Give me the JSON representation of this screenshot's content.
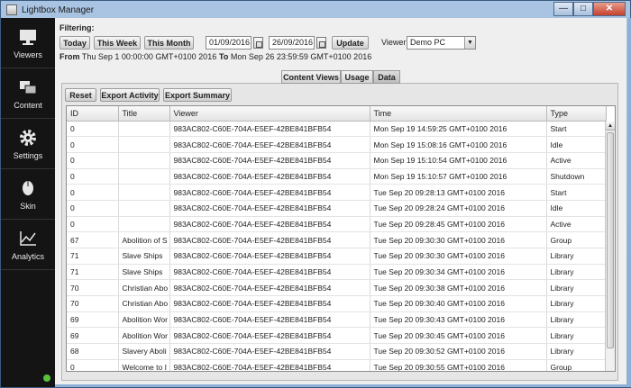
{
  "window": {
    "title": "Lightbox Manager",
    "min": "—",
    "max": "□",
    "close": "✕"
  },
  "sidebar": {
    "items": [
      {
        "label": "Viewers",
        "icon": "monitor-icon"
      },
      {
        "label": "Content",
        "icon": "content-icon"
      },
      {
        "label": "Settings",
        "icon": "gear-icon"
      },
      {
        "label": "Skin",
        "icon": "mouse-icon"
      },
      {
        "label": "Analytics",
        "icon": "chart-icon"
      }
    ]
  },
  "filter": {
    "title": "Filtering:",
    "today": "Today",
    "this_week": "This Week",
    "this_month": "This Month",
    "date_from": "01/09/2016",
    "date_to": "26/09/2016",
    "update": "Update",
    "viewer_label": "Viewer",
    "viewer_value": "Demo PC",
    "from_label": "From",
    "from_value": "Thu Sep 1 00:00:00 GMT+0100 2016",
    "to_label": "To",
    "to_value": "Mon Sep 26 23:59:59 GMT+0100 2016"
  },
  "tabs": [
    "Content Views",
    "Usage",
    "Data"
  ],
  "actions": {
    "reset": "Reset",
    "export_activity": "Export Activity",
    "export_summary": "Export Summary"
  },
  "table": {
    "columns": [
      "ID",
      "Title",
      "Viewer",
      "Time",
      "Type"
    ],
    "rows": [
      [
        "0",
        "",
        "983AC802-C60E-704A-E5EF-42BE841BFB54",
        "Mon Sep 19 14:59:25 GMT+0100 2016",
        "Start"
      ],
      [
        "0",
        "",
        "983AC802-C60E-704A-E5EF-42BE841BFB54",
        "Mon Sep 19 15:08:16 GMT+0100 2016",
        "Idle"
      ],
      [
        "0",
        "",
        "983AC802-C60E-704A-E5EF-42BE841BFB54",
        "Mon Sep 19 15:10:54 GMT+0100 2016",
        "Active"
      ],
      [
        "0",
        "",
        "983AC802-C60E-704A-E5EF-42BE841BFB54",
        "Mon Sep 19 15:10:57 GMT+0100 2016",
        "Shutdown"
      ],
      [
        "0",
        "",
        "983AC802-C60E-704A-E5EF-42BE841BFB54",
        "Tue Sep 20 09:28:13 GMT+0100 2016",
        "Start"
      ],
      [
        "0",
        "",
        "983AC802-C60E-704A-E5EF-42BE841BFB54",
        "Tue Sep 20 09:28:24 GMT+0100 2016",
        "Idle"
      ],
      [
        "0",
        "",
        "983AC802-C60E-704A-E5EF-42BE841BFB54",
        "Tue Sep 20 09:28:45 GMT+0100 2016",
        "Active"
      ],
      [
        "67",
        "Abolition of S",
        "983AC802-C60E-704A-E5EF-42BE841BFB54",
        "Tue Sep 20 09:30:30 GMT+0100 2016",
        "Group"
      ],
      [
        "71",
        "Slave Ships",
        "983AC802-C60E-704A-E5EF-42BE841BFB54",
        "Tue Sep 20 09:30:30 GMT+0100 2016",
        "Library"
      ],
      [
        "71",
        "Slave Ships",
        "983AC802-C60E-704A-E5EF-42BE841BFB54",
        "Tue Sep 20 09:30:34 GMT+0100 2016",
        "Library"
      ],
      [
        "70",
        "Christian Abo",
        "983AC802-C60E-704A-E5EF-42BE841BFB54",
        "Tue Sep 20 09:30:38 GMT+0100 2016",
        "Library"
      ],
      [
        "70",
        "Christian Abo",
        "983AC802-C60E-704A-E5EF-42BE841BFB54",
        "Tue Sep 20 09:30:40 GMT+0100 2016",
        "Library"
      ],
      [
        "69",
        "Abolition Wor",
        "983AC802-C60E-704A-E5EF-42BE841BFB54",
        "Tue Sep 20 09:30:43 GMT+0100 2016",
        "Library"
      ],
      [
        "69",
        "Abolition Wor",
        "983AC802-C60E-704A-E5EF-42BE841BFB54",
        "Tue Sep 20 09:30:45 GMT+0100 2016",
        "Library"
      ],
      [
        "68",
        "Slavery Aboli",
        "983AC802-C60E-704A-E5EF-42BE841BFB54",
        "Tue Sep 20 09:30:52 GMT+0100 2016",
        "Library"
      ],
      [
        "0",
        "Welcome to I",
        "983AC802-C60E-704A-E5EF-42BE841BFB54",
        "Tue Sep 20 09:30:55 GMT+0100 2016",
        "Group"
      ]
    ]
  },
  "colors": {
    "sidebar_bg": "#141414",
    "status_online": "#58c23b"
  }
}
